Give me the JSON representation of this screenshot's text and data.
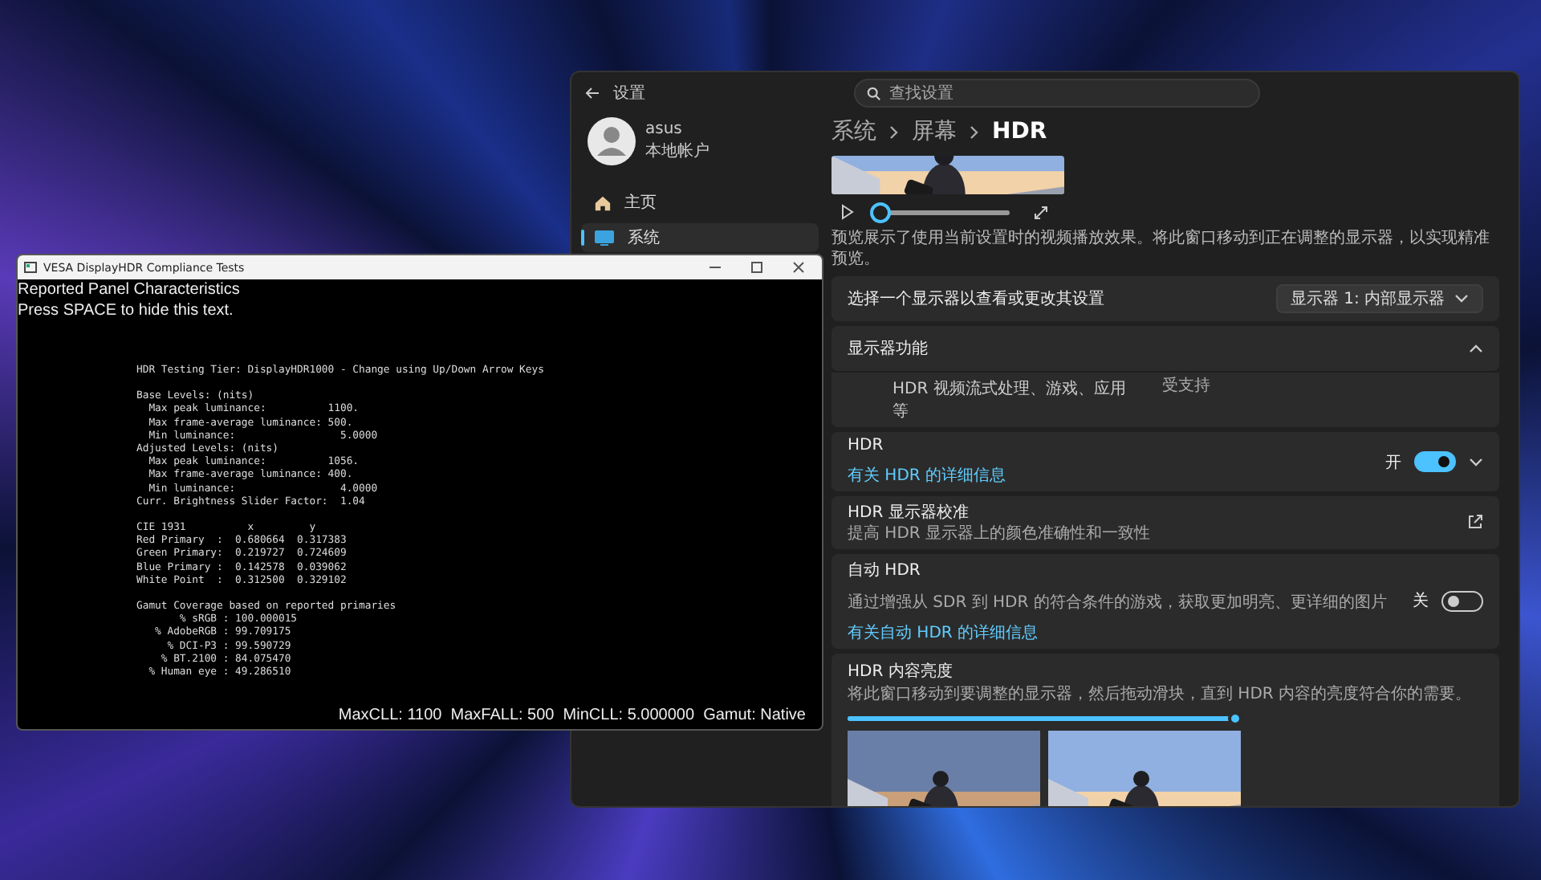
{
  "console_window": {
    "title": "VESA DisplayHDR Compliance Tests",
    "header": [
      "Reported Panel Characteristics",
      "Press SPACE to hide this text."
    ],
    "blocks": [
      [
        "HDR Testing Tier: DisplayHDR1000 - Change using Up/Down Arrow Keys"
      ],
      [
        "Base Levels: (nits)",
        "  Max peak luminance:          1100.",
        "  Max frame-average luminance: 500.",
        "  Min luminance:                 5.0000",
        "Adjusted Levels: (nits)",
        "  Max peak luminance:          1056.",
        "  Max frame-average luminance: 400.",
        "  Min luminance:                 4.0000",
        "Curr. Brightness Slider Factor:  1.04"
      ],
      [
        "CIE 1931          x         y",
        "Red Primary  :  0.680664  0.317383",
        "Green Primary:  0.219727  0.724609",
        "Blue Primary :  0.142578  0.039062",
        "White Point  :  0.312500  0.329102"
      ],
      [
        "Gamut Coverage based on reported primaries",
        "       % sRGB : 100.000015",
        "   % AdobeRGB : 99.709175",
        "     % DCI-P3 : 99.590729",
        "    % BT.2100 : 84.075470",
        "  % Human eye : 49.286510"
      ]
    ],
    "status": "MaxCLL: 1100  MaxFALL: 500  MinCLL: 5.000000  Gamut: Native"
  },
  "settings_window": {
    "title": "设置",
    "search": {
      "placeholder": "查找设置"
    },
    "account": {
      "name": "asus",
      "type": "本地帐户"
    },
    "nav": [
      {
        "label": "主页",
        "selected": false
      },
      {
        "label": "系统",
        "selected": true
      }
    ],
    "breadcrumb": [
      "系统",
      "屏幕",
      "HDR"
    ],
    "preview": {
      "level": 0
    },
    "preview_note": "预览展示了使用当前设置时的视频播放效果。将此窗口移动到正在调整的显示器，以实现精准预览。",
    "cards": [
      {
        "kind": "select",
        "title": "选择一个显示器以查看或更改其设置",
        "value": "显示器 1: 内部显示器"
      },
      {
        "kind": "expander",
        "title": "显示器功能",
        "expanded": true,
        "rows": [
          {
            "label": "HDR 视频流式处理、游戏、应用等",
            "value": "受支持"
          }
        ]
      },
      {
        "kind": "toggle",
        "title": "HDR",
        "link": "有关 HDR 的详细信息",
        "state_label": "开",
        "on": true
      },
      {
        "kind": "external",
        "title": "HDR 显示器校准",
        "description": "提高 HDR 显示器上的颜色准确性和一致性"
      },
      {
        "kind": "toggle",
        "title": "自动 HDR",
        "description": "通过增强从 SDR 到 HDR 的符合条件的游戏，获取更加明亮、更详细的图片",
        "link": "有关自动 HDR 的详细信息",
        "state_label": "关",
        "on": false
      },
      {
        "kind": "brightness",
        "title": "HDR 内容亮度",
        "description": "将此窗口移动到要调整的显示器，然后拖动滑块，直到 HDR 内容的亮度符合你的需要。",
        "level": 1
      }
    ]
  }
}
